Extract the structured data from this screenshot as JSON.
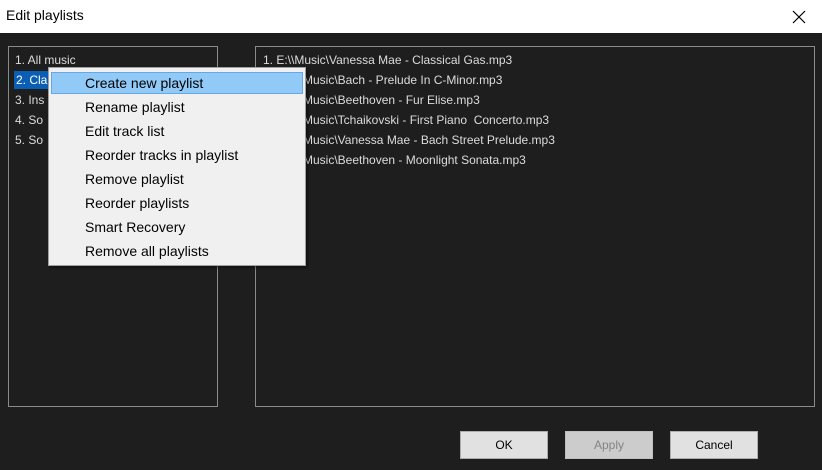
{
  "window": {
    "title": "Edit playlists"
  },
  "playlists": [
    "1. All music",
    "2. Cla",
    "3. Ins",
    "4. So",
    "5. So"
  ],
  "tracks": [
    "1. E:\\\\Music\\Vanessa Mae - Classical Gas.mp3",
    "Music\\Bach - Prelude In C-Minor.mp3",
    "Music\\Beethoven - Fur Elise.mp3",
    "Music\\Tchaikovski - First Piano  Concerto.mp3",
    "Music\\Vanessa Mae - Bach Street Prelude.mp3",
    "Music\\Beethoven - Moonlight Sonata.mp3"
  ],
  "context_menu": [
    "Create new playlist",
    "Rename playlist",
    "Edit track list",
    "Reorder tracks in playlist",
    "Remove playlist",
    "Reorder playlists",
    "Smart Recovery",
    "Remove all playlists"
  ],
  "buttons": {
    "ok": "OK",
    "apply": "Apply",
    "cancel": "Cancel"
  },
  "colors": {
    "background": "#1e1e1e",
    "selection": "#0a5fb4",
    "menu_highlight": "#91c9f7"
  }
}
